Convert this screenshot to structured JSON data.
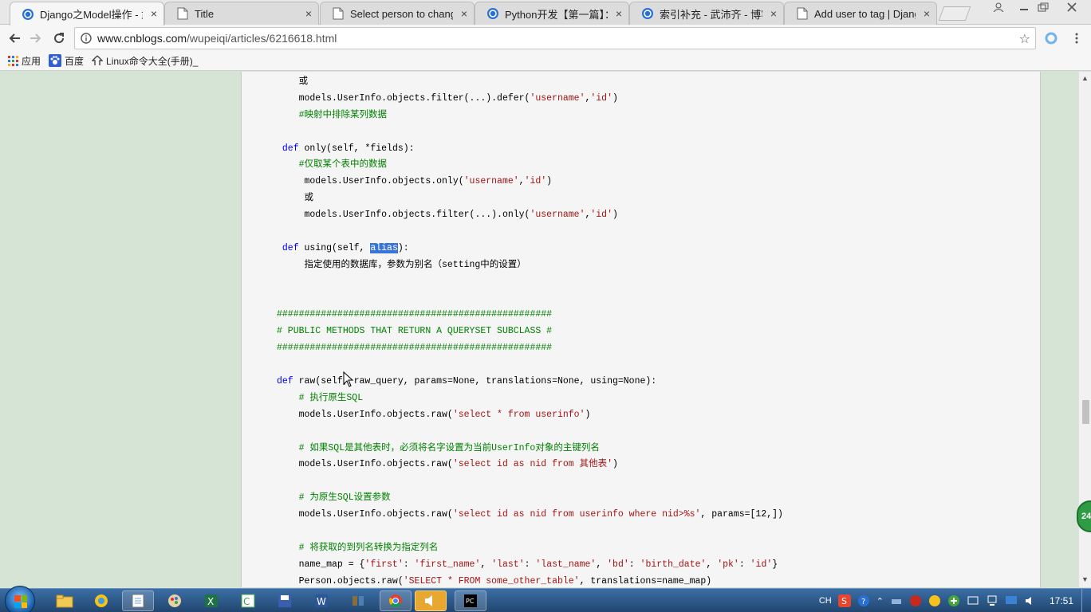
{
  "tabs": [
    {
      "title": "Django之Model操作 - 武",
      "active": true,
      "icon": "cnblogs-icon"
    },
    {
      "title": "Title",
      "active": false,
      "icon": "page-icon"
    },
    {
      "title": "Select person to chang",
      "active": false,
      "icon": "page-icon"
    },
    {
      "title": "Python开发【第一篇】：",
      "active": false,
      "icon": "cnblogs-icon"
    },
    {
      "title": "索引补充 - 武沛齐 - 博客",
      "active": false,
      "icon": "cnblogs-icon"
    },
    {
      "title": "Add user to tag | Djang",
      "active": false,
      "icon": "page-icon"
    }
  ],
  "close_glyph": "×",
  "address": {
    "host": "www.cnblogs.com",
    "path": "/wupeiqi/articles/6216618.html"
  },
  "bookmarks": [
    {
      "label": "应用",
      "icon": "apps-grid-icon"
    },
    {
      "label": "百度",
      "icon": "baidu-paw-icon"
    },
    {
      "label": "Linux命令大全(手册)_",
      "icon": "linux-icon"
    }
  ],
  "code_lines": [
    [
      {
        "t": "    或",
        "c": ""
      }
    ],
    [
      {
        "t": "    models.UserInfo.objects.filter(...).defer(",
        "c": ""
      },
      {
        "t": "'username'",
        "c": "st"
      },
      {
        "t": ",",
        "c": ""
      },
      {
        "t": "'id'",
        "c": "st"
      },
      {
        "t": ")",
        "c": ""
      }
    ],
    [
      {
        "t": "    #映射中排除某列数据",
        "c": "cm"
      }
    ],
    [
      {
        "t": "",
        "c": ""
      }
    ],
    [
      {
        "t": " ",
        "c": ""
      },
      {
        "t": "def",
        "c": "kw"
      },
      {
        "t": " only(self, *fields):",
        "c": ""
      }
    ],
    [
      {
        "t": "    #仅取某个表中的数据",
        "c": "cm"
      }
    ],
    [
      {
        "t": "     models.UserInfo.objects.only(",
        "c": ""
      },
      {
        "t": "'username'",
        "c": "st"
      },
      {
        "t": ",",
        "c": ""
      },
      {
        "t": "'id'",
        "c": "st"
      },
      {
        "t": ")",
        "c": ""
      }
    ],
    [
      {
        "t": "     或",
        "c": ""
      }
    ],
    [
      {
        "t": "     models.UserInfo.objects.filter(...).only(",
        "c": ""
      },
      {
        "t": "'username'",
        "c": "st"
      },
      {
        "t": ",",
        "c": ""
      },
      {
        "t": "'id'",
        "c": "st"
      },
      {
        "t": ")",
        "c": ""
      }
    ],
    [
      {
        "t": "",
        "c": ""
      }
    ],
    [
      {
        "t": " ",
        "c": ""
      },
      {
        "t": "def",
        "c": "kw"
      },
      {
        "t": " using(self, ",
        "c": ""
      },
      {
        "t": "alias",
        "c": "sel"
      },
      {
        "t": "):",
        "c": ""
      }
    ],
    [
      {
        "t": "     指定使用的数据库，参数为别名（setting中的设置）",
        "c": ""
      }
    ],
    [
      {
        "t": "",
        "c": ""
      }
    ],
    [
      {
        "t": "",
        "c": ""
      }
    ],
    [
      {
        "t": "##################################################",
        "c": "cm"
      }
    ],
    [
      {
        "t": "# PUBLIC METHODS THAT RETURN A QUERYSET SUBCLASS #",
        "c": "cm"
      }
    ],
    [
      {
        "t": "##################################################",
        "c": "cm"
      }
    ],
    [
      {
        "t": "",
        "c": ""
      }
    ],
    [
      {
        "t": "def",
        "c": "kw"
      },
      {
        "t": " raw(self, raw_query, params=None, translations=None, using=None):",
        "c": ""
      }
    ],
    [
      {
        "t": "    # 执行原生SQL",
        "c": "cm"
      }
    ],
    [
      {
        "t": "    models.UserInfo.objects.raw(",
        "c": ""
      },
      {
        "t": "'select * from userinfo'",
        "c": "st"
      },
      {
        "t": ")",
        "c": ""
      }
    ],
    [
      {
        "t": "",
        "c": ""
      }
    ],
    [
      {
        "t": "    # 如果SQL是其他表时，必须将名字设置为当前UserInfo对象的主键列名",
        "c": "cm"
      }
    ],
    [
      {
        "t": "    models.UserInfo.objects.raw(",
        "c": ""
      },
      {
        "t": "'select id as nid from 其他表'",
        "c": "st"
      },
      {
        "t": ")",
        "c": ""
      }
    ],
    [
      {
        "t": "",
        "c": ""
      }
    ],
    [
      {
        "t": "    # 为原生SQL设置参数",
        "c": "cm"
      }
    ],
    [
      {
        "t": "    models.UserInfo.objects.raw(",
        "c": ""
      },
      {
        "t": "'select id as nid from userinfo where nid>%s'",
        "c": "st"
      },
      {
        "t": ", params=[12,])",
        "c": ""
      }
    ],
    [
      {
        "t": "",
        "c": ""
      }
    ],
    [
      {
        "t": "    # 将获取的到列名转换为指定列名",
        "c": "cm"
      }
    ],
    [
      {
        "t": "    name_map = {",
        "c": ""
      },
      {
        "t": "'first'",
        "c": "st"
      },
      {
        "t": ": ",
        "c": ""
      },
      {
        "t": "'first_name'",
        "c": "st"
      },
      {
        "t": ", ",
        "c": ""
      },
      {
        "t": "'last'",
        "c": "st"
      },
      {
        "t": ": ",
        "c": ""
      },
      {
        "t": "'last_name'",
        "c": "st"
      },
      {
        "t": ", ",
        "c": ""
      },
      {
        "t": "'bd'",
        "c": "st"
      },
      {
        "t": ": ",
        "c": ""
      },
      {
        "t": "'birth_date'",
        "c": "st"
      },
      {
        "t": ", ",
        "c": ""
      },
      {
        "t": "'pk'",
        "c": "st"
      },
      {
        "t": ": ",
        "c": ""
      },
      {
        "t": "'id'",
        "c": "st"
      },
      {
        "t": "}",
        "c": ""
      }
    ],
    [
      {
        "t": "    Person.objects.raw(",
        "c": ""
      },
      {
        "t": "'SELECT * FROM some_other_table'",
        "c": "st"
      },
      {
        "t": ", translations=name_map)",
        "c": ""
      }
    ]
  ],
  "floating_badge": "24",
  "taskbar": {
    "apps": [
      {
        "name": "explorer",
        "icon": "folder-icon",
        "open": false
      },
      {
        "name": "qq-browser",
        "icon": "qq-icon",
        "open": false
      },
      {
        "name": "notepad",
        "icon": "notepad-icon",
        "open": true
      },
      {
        "name": "paint",
        "icon": "paint-icon",
        "open": false
      },
      {
        "name": "excel",
        "icon": "excel-icon",
        "open": false
      },
      {
        "name": "notepad-plus",
        "icon": "notepad-plus-icon",
        "open": false
      },
      {
        "name": "save",
        "icon": "save-icon",
        "open": false
      },
      {
        "name": "word",
        "icon": "word-icon",
        "open": false
      },
      {
        "name": "tools",
        "icon": "tools-icon",
        "open": false
      },
      {
        "name": "chrome",
        "icon": "chrome-icon",
        "open": true
      },
      {
        "name": "player",
        "icon": "speaker-app-icon",
        "open": true
      },
      {
        "name": "pycharm",
        "icon": "pycharm-icon",
        "open": true
      }
    ],
    "ime": "CH",
    "clock": "17:51"
  }
}
